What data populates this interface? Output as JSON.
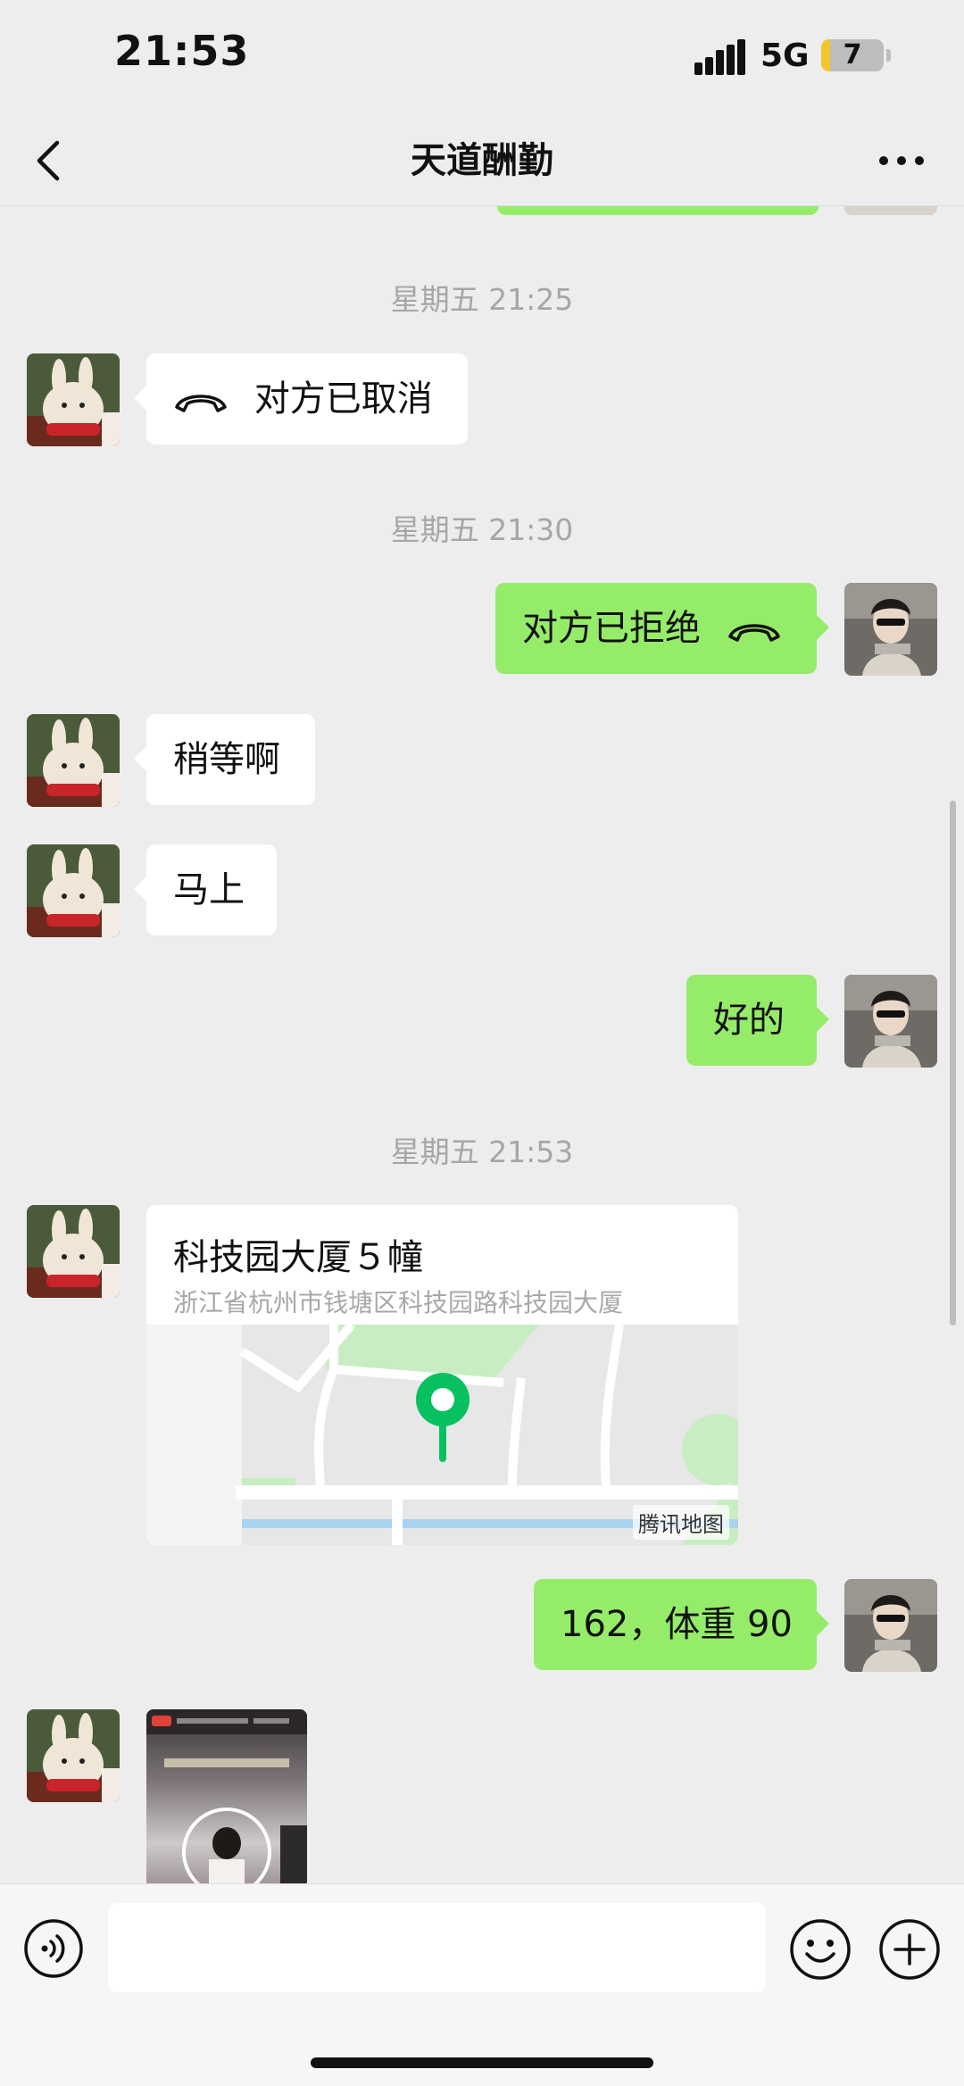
{
  "status_bar": {
    "time": "21:53",
    "network": "5G",
    "battery": "7"
  },
  "nav": {
    "title": "天道酬勤"
  },
  "messages": {
    "ts1": "星期五 21:25",
    "call_cancelled": "对方已取消",
    "ts2": "星期五 21:30",
    "call_rejected": "对方已拒绝",
    "wait": "稍等啊",
    "soon": "马上",
    "ok": "好的",
    "ts3": "星期五 21:53",
    "height_weight": "162，体重 90"
  },
  "location": {
    "name": "科技园大厦５幢",
    "address": "浙江省杭州市钱塘区科技园路科技园大厦",
    "map_credit": "腾讯地图"
  },
  "colors": {
    "sent_bubble": "#95ec69",
    "received_bubble": "#ffffff",
    "pin": "#07c160",
    "background": "#ededed"
  },
  "icons": [
    "back-arrow-icon",
    "more-dots-icon",
    "phone-hangup-icon",
    "voice-icon",
    "emoji-icon",
    "plus-icon",
    "map-pin-icon"
  ]
}
